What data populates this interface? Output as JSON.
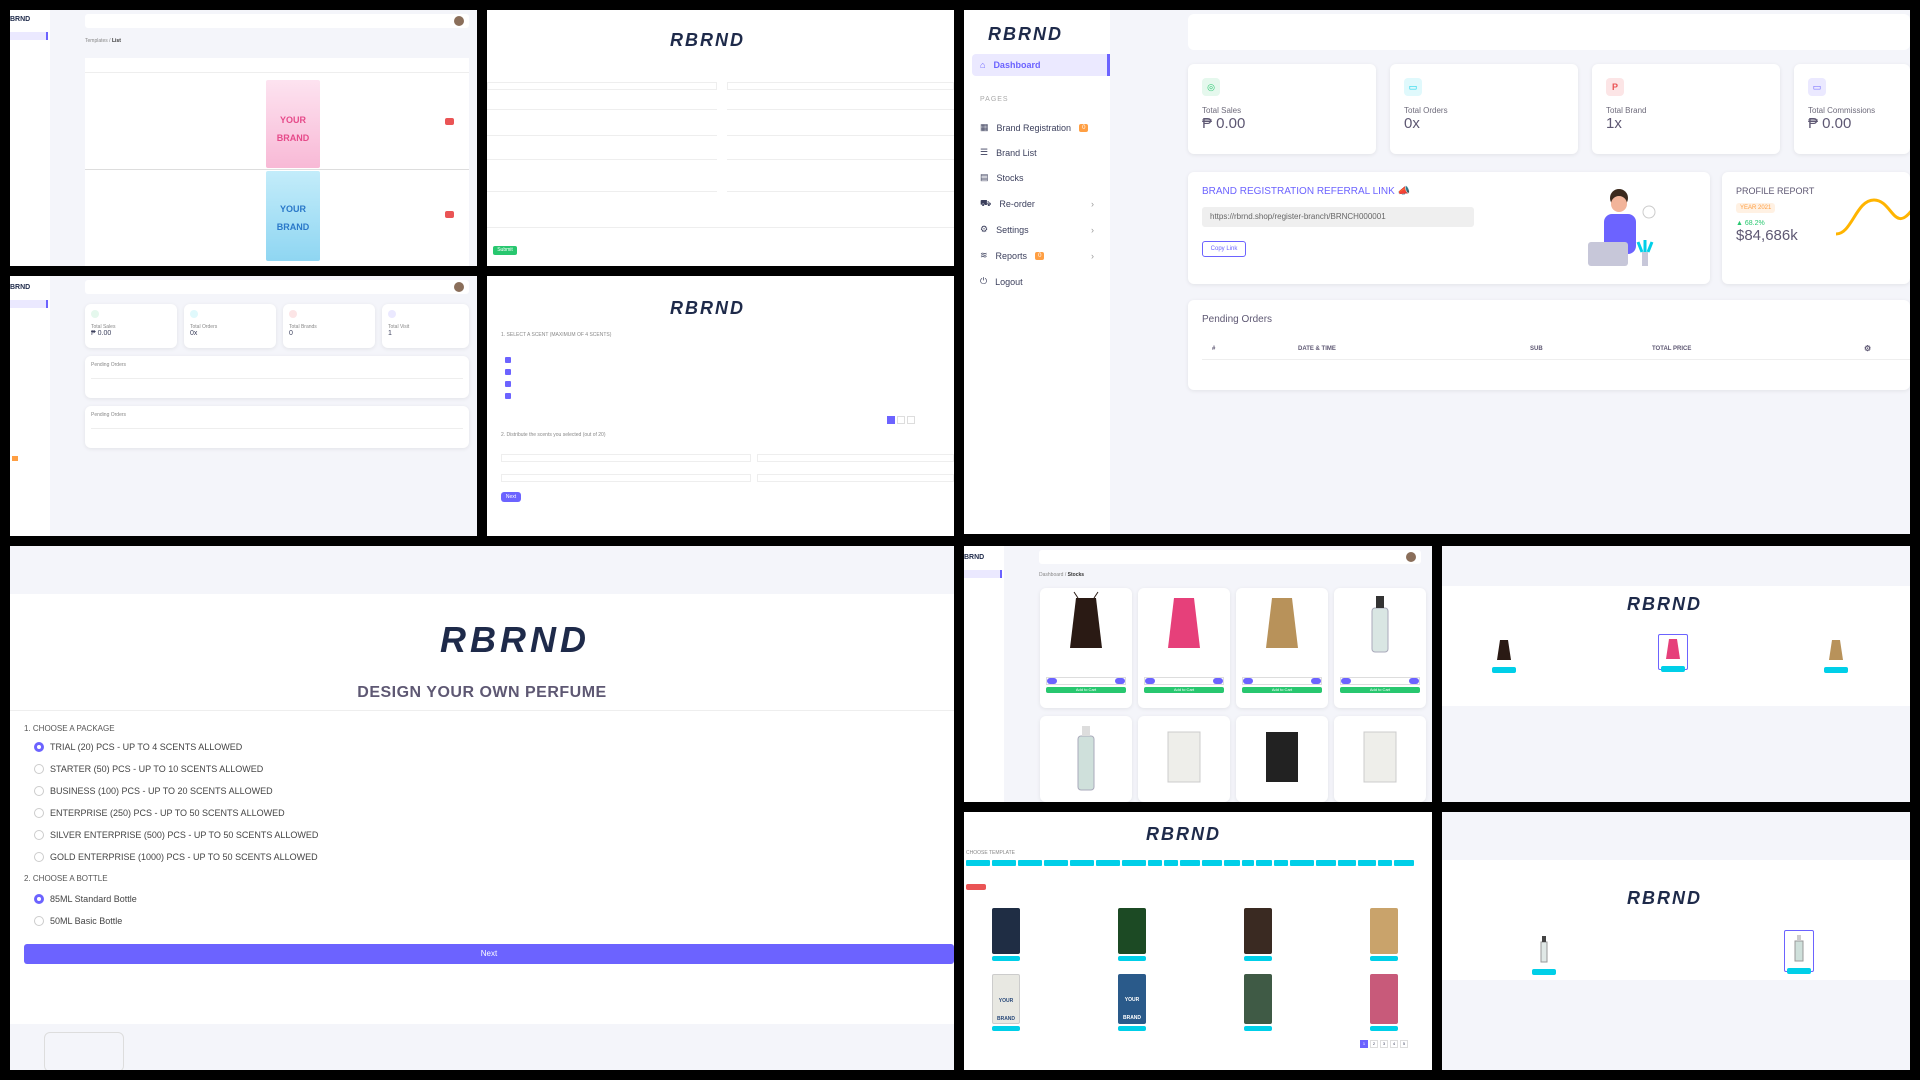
{
  "brand": {
    "logo_text": "RBRND",
    "accent": "#6c63ff",
    "green": "#28c76f",
    "cyan": "#00cfe8",
    "red": "#ea5455",
    "orange": "#ff9f43",
    "logo_color": "#1e2a4a"
  },
  "templates_list": {
    "breadcrumb_parent": "Templates",
    "breadcrumb_sep": " / ",
    "breadcrumb_current": "List",
    "poster_text": "YOUR BRAND"
  },
  "register_form": {
    "submit_label": "Submit"
  },
  "dashboard_small": {
    "stats": [
      {
        "label": "Total Sales",
        "value": "₱ 0.00"
      },
      {
        "label": "Total Orders",
        "value": "0x"
      },
      {
        "label": "Total Brands",
        "value": "0"
      },
      {
        "label": "Total Visit",
        "value": "1"
      }
    ],
    "pending_title": "Pending Orders"
  },
  "scent_select": {
    "heading1": "1. SELECT A SCENT (MAXIMUM OF 4 SCENTS)",
    "heading2": "2. Distribute the scents you selected (out of 20)",
    "next_label": "Next"
  },
  "dashboard": {
    "sidebar": {
      "items": [
        {
          "label": "Dashboard",
          "icon": "home-icon"
        },
        {
          "label": "PAGES"
        },
        {
          "label": "Brand Registration",
          "badge": "0"
        },
        {
          "label": "Brand List"
        },
        {
          "label": "Stocks"
        },
        {
          "label": "Re-order"
        },
        {
          "label": "Settings"
        },
        {
          "label": "Reports",
          "badge": "0"
        },
        {
          "label": "Logout"
        }
      ]
    },
    "stats": [
      {
        "label": "Total Sales",
        "value": "₱ 0.00",
        "icon_color": "#28c76f",
        "icon_bg": "#e5f8ed"
      },
      {
        "label": "Total Orders",
        "value": "0x",
        "icon_color": "#00cfe8",
        "icon_bg": "#e0f9fc"
      },
      {
        "label": "Total Brand",
        "value": "1x",
        "icon_color": "#ea5455",
        "icon_bg": "#fce5e6"
      },
      {
        "label": "Total Commissions",
        "value": "₱ 0.00",
        "icon_color": "#6c63ff",
        "icon_bg": "#ebe9ff"
      }
    ],
    "referral": {
      "title": "BRAND REGISTRATION REFERRAL LINK",
      "link": "https://rbrnd.shop/register-branch/BRNCH000001",
      "copy_label": "Copy Link"
    },
    "profile": {
      "title": "PROFILE REPORT",
      "year": "YEAR 2021",
      "growth": "68.2%",
      "value": "$84,686k"
    },
    "pending": {
      "title": "Pending Orders",
      "columns": [
        "#",
        "DATE & TIME",
        "SUB",
        "TOTAL PRICE"
      ]
    }
  },
  "design": {
    "title": "DESIGN YOUR OWN PERFUME",
    "section1": "1. CHOOSE A PACKAGE",
    "packages": [
      {
        "label": "TRIAL (20) PCS - UP TO 4 SCENTS ALLOWED",
        "selected": true
      },
      {
        "label": "STARTER (50) PCS - UP TO 10 SCENTS ALLOWED",
        "selected": false
      },
      {
        "label": "BUSINESS (100) PCS - UP TO 20 SCENTS ALLOWED",
        "selected": false
      },
      {
        "label": "ENTERPRISE (250) PCS - UP TO 50 SCENTS ALLOWED",
        "selected": false
      },
      {
        "label": "SILVER ENTERPRISE (500) PCS - UP TO 50 SCENTS ALLOWED",
        "selected": false
      },
      {
        "label": "GOLD ENTERPRISE (1000) PCS - UP TO 50 SCENTS ALLOWED",
        "selected": false
      }
    ],
    "section2": "2. CHOOSE A BOTTLE",
    "bottles": [
      {
        "label": "85ML Standard Bottle",
        "selected": true
      },
      {
        "label": "50ML Basic Bottle",
        "selected": false
      }
    ],
    "next_label": "Next"
  },
  "stocks": {
    "breadcrumb_parent": "Dashboard",
    "breadcrumb_sep": " / ",
    "breadcrumb_current": "Stocks",
    "add_label": "Add to Cart"
  },
  "template_select": {
    "heading": "CHOOSE TEMPLATE",
    "poster_text": "YOUR BRAND",
    "pagination": [
      "1",
      "2",
      "3",
      "4",
      "5"
    ]
  }
}
